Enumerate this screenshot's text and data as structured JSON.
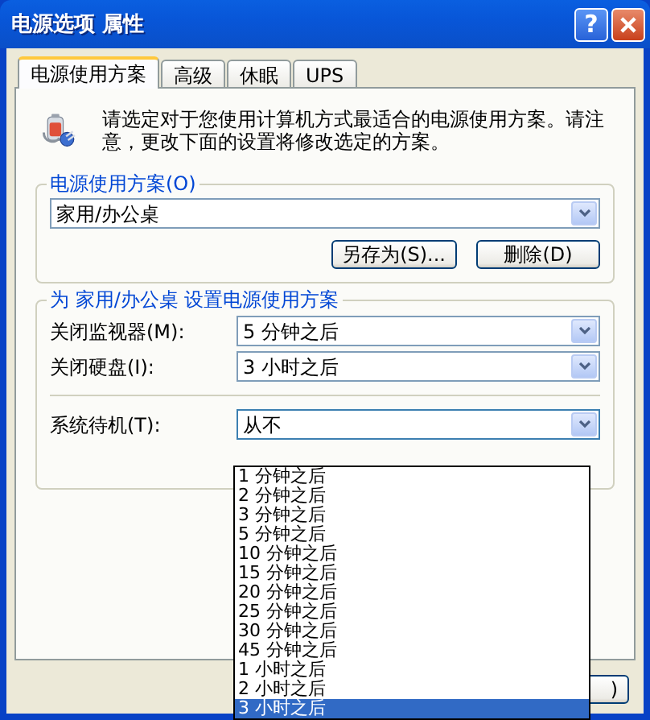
{
  "window": {
    "title": "电源选项 属性",
    "help_button": {
      "label": "?"
    }
  },
  "tabs": [
    {
      "label": "电源使用方案",
      "selected": true
    },
    {
      "label": "高级",
      "selected": false
    },
    {
      "label": "休眠",
      "selected": false
    },
    {
      "label": "UPS",
      "selected": false
    }
  ],
  "intro": "请选定对于您使用计算机方式最适合的电源使用方案。请注意，更改下面的设置将修改选定的方案。",
  "plan_group": {
    "caption": "电源使用方案(O)",
    "value": "家用/办公桌",
    "buttons": [
      {
        "label": "另存为(S)..."
      },
      {
        "label": "删除(D)"
      }
    ]
  },
  "settings_group": {
    "caption": "为 家用/办公桌 设置电源使用方案",
    "rows": [
      {
        "kind": "dropdown",
        "label": "关闭监视器(M):",
        "value": "5 分钟之后",
        "expanded": false
      },
      {
        "kind": "dropdown",
        "label": "关闭硬盘(I):",
        "value": "3 小时之后",
        "expanded": false
      },
      {
        "kind": "separator"
      },
      {
        "kind": "dropdown",
        "label": "系统待机(T):",
        "value": "从不",
        "expanded": true
      }
    ]
  },
  "dropdown": {
    "options": [
      {
        "label": "1 分钟之后",
        "selected": false
      },
      {
        "label": "2 分钟之后",
        "selected": false
      },
      {
        "label": "3 分钟之后",
        "selected": false
      },
      {
        "label": "5 分钟之后",
        "selected": false
      },
      {
        "label": "10 分钟之后",
        "selected": false
      },
      {
        "label": "15 分钟之后",
        "selected": false
      },
      {
        "label": "20 分钟之后",
        "selected": false
      },
      {
        "label": "25 分钟之后",
        "selected": false
      },
      {
        "label": "30 分钟之后",
        "selected": false
      },
      {
        "label": "45 分钟之后",
        "selected": false
      },
      {
        "label": "1 小时之后",
        "selected": false
      },
      {
        "label": "2 小时之后",
        "selected": false
      },
      {
        "label": "3 小时之后",
        "selected": true
      }
    ]
  },
  "bottom_buttons": [
    {
      "label": ")"
    }
  ]
}
